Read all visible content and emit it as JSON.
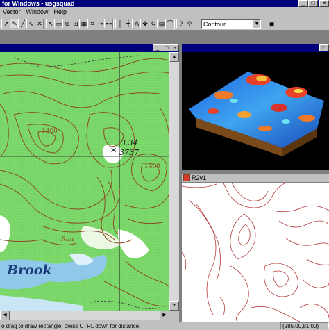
{
  "app": {
    "title": "for Windows - usgsquad",
    "title_buttons": [
      "_",
      "□",
      "×"
    ]
  },
  "menu": [
    "Vector",
    "Window",
    "Help"
  ],
  "toolbar": {
    "tools": [
      {
        "name": "pointer-tool",
        "glyph": "↗"
      },
      {
        "name": "draw-tool",
        "glyph": "✎"
      },
      {
        "name": "line-tool",
        "glyph": "╱"
      },
      {
        "name": "node-tool",
        "glyph": "∿"
      },
      {
        "name": "erase-tool",
        "glyph": "✕"
      },
      {
        "name": "select-arrow-tool",
        "glyph": "↖"
      },
      {
        "name": "rect-select-tool",
        "glyph": "▭"
      },
      {
        "name": "zoom-tool",
        "glyph": "⊕"
      },
      {
        "name": "fit-tool",
        "glyph": "⊞"
      },
      {
        "name": "grid-tool",
        "glyph": "▦"
      },
      {
        "name": "snap-tool",
        "glyph": "⌗"
      },
      {
        "name": "link-tool",
        "glyph": "⊸"
      },
      {
        "name": "connect-tool",
        "glyph": "⊷"
      },
      {
        "name": "split-tool",
        "glyph": "┼"
      },
      {
        "name": "join-tool",
        "glyph": "┿"
      },
      {
        "name": "label-tool",
        "glyph": "A"
      },
      {
        "name": "move-tool",
        "glyph": "✥"
      },
      {
        "name": "rotate-tool",
        "glyph": "↻"
      },
      {
        "name": "attribute-tool",
        "glyph": "▤"
      },
      {
        "name": "curve-tool",
        "glyph": "⌒"
      },
      {
        "name": "query-tool",
        "glyph": "?"
      },
      {
        "name": "pin-tool",
        "glyph": "⚲"
      }
    ],
    "mode_select": "Contour",
    "mode_arrow": "▼"
  },
  "map_window": {
    "buttons": [
      "_",
      "□",
      "×"
    ],
    "labels": {
      "elev1": "1400",
      "elev2": "1400",
      "spot1": "3.34",
      "spot2": "3737",
      "brook": "Brook",
      "ran": "Ran"
    }
  },
  "window_3d": {
    "buttons": [
      "□"
    ]
  },
  "r2v_window": {
    "title": "R2v1"
  },
  "status": {
    "message": "o drag to draw rectangle, press CTRL down for distance.",
    "coords": "(285.00,81.00)"
  },
  "colors": {
    "titlebar": "#00007b",
    "map_green": "#7dd86c",
    "contour_brown": "#8b4a22",
    "vector_red": "#b33a3a",
    "water_blue": "#8fc8e8"
  }
}
